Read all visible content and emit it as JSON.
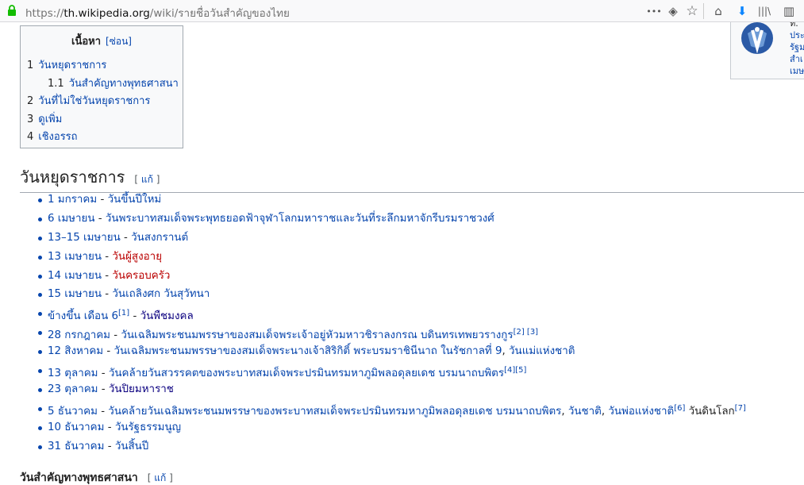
{
  "browser": {
    "url_scheme": "https://",
    "url_host": "th.wikipedia.org",
    "url_path": "/wiki/รายชื่อวันสำคัญของไทย",
    "menu_glyph": "•••",
    "pocket_glyph": "◈",
    "star_glyph": "☆",
    "home_glyph": "⌂",
    "download_glyph": "⬇",
    "library_glyph": "|||\\",
    "sidebar_glyph": "▥"
  },
  "toc": {
    "title": "เนื้อหา",
    "toggle": "[ซ่อน]",
    "items": [
      {
        "num": "1",
        "label": "วันหยุดราชการ"
      },
      {
        "num": "1.1",
        "label": "วันสำคัญทางพุทธศาสนา"
      },
      {
        "num": "2",
        "label": "วันที่ไม่ใช่วันหยุดราชการ"
      },
      {
        "num": "3",
        "label": "ดูเพิ่ม"
      },
      {
        "num": "4",
        "label": "เชิงอรรถ"
      }
    ]
  },
  "infobox": {
    "lines": [
      "ท.",
      "ประ",
      "รัฐม",
      "สำเ",
      "เมษ"
    ]
  },
  "section1": {
    "title": "วันหยุดราชการ",
    "edit_open": "[ ",
    "edit_link": "แก้",
    "edit_close": " ]"
  },
  "holidays": [
    {
      "date": "1 มกราคม",
      "sep": " - ",
      "name": "วันขึ้นปีใหม่"
    },
    {
      "date": "6 เมษายน",
      "sep": " - ",
      "name": "วันพระบาทสมเด็จพระพุทธยอดฟ้าจุฬาโลกมหาราชและวันที่ระลึกมหาจักรีบรมราชวงศ์"
    },
    {
      "date": "13–15 เมษายน",
      "sep": " - ",
      "name": "วันสงกรานต์"
    },
    {
      "date": "13 เมษายน",
      "sep": " - ",
      "name": "วันผู้สูงอายุ"
    },
    {
      "date": "14 เมษายน",
      "sep": " - ",
      "name": "วันครอบครัว"
    },
    {
      "date": "15 เมษายน",
      "sep": " - ",
      "name": "วันเถลิงศก วันสุวัทนา"
    },
    {
      "date": "ข้างขึ้น เดือน 6",
      "ref": "[1]",
      "sep": " - ",
      "name": "วันพืชมงคล"
    },
    {
      "date": "28 กรกฎาคม",
      "sep": " - ",
      "name": "วันเฉลิมพระชนมพรรษาของสมเด็จพระเจ้าอยู่หัวมหาวชิราลงกรณ บดินทรเทพยวรางกูร",
      "ref2": "[2] [3]"
    },
    {
      "date": "12 สิงหาคม",
      "sep": " - ",
      "name": "วันเฉลิมพระชนมพรรษาของสมเด็จพระนางเจ้าสิริกิติ์ พระบรมราชินีนาถ ในรัชกาลที่ 9",
      "sep2": ", ",
      "name2": "วันแม่แห่งชาติ"
    },
    {
      "date": "13 ตุลาคม",
      "sep": " - ",
      "name": "วันคล้ายวันสวรรคตของพระบาทสมเด็จพระปรมินทรมหาภูมิพลอดุลยเดช บรมนาถบพิตร",
      "ref2": "[4][5]"
    },
    {
      "date": "23 ตุลาคม",
      "sep": " - ",
      "name": "วันปิยมหาราช"
    },
    {
      "date": "5 ธันวาคม",
      "sep": " - ",
      "name": "วันคล้ายวันเฉลิมพระชนมพรรษาของพระบาทสมเด็จพระปรมินทรมหาภูมิพลอดุลยเดช บรมนาถบพิตร",
      "sep2": ", ",
      "name2": "วันชาติ",
      "sep3": ", ",
      "name3": "วันพ่อแห่งชาติ",
      "ref3": "[6]",
      "plain": " วันดินโลก",
      "ref4": "[7]"
    },
    {
      "date": "10 ธันวาคม",
      "sep": " - ",
      "name": "วันรัฐธรรมนูญ"
    },
    {
      "date": "31 ธันวาคม",
      "sep": " - ",
      "name": "วันสิ้นปี"
    }
  ],
  "section2": {
    "title": "วันสำคัญทางพุทธศาสนา",
    "edit_open": "[ ",
    "edit_link": "แก้",
    "edit_close": " ]"
  },
  "colors": {
    "link": "#0645ad",
    "redlink": "#ba0000",
    "download_blue": "#0a84ff",
    "lock_green": "#12bc00"
  }
}
